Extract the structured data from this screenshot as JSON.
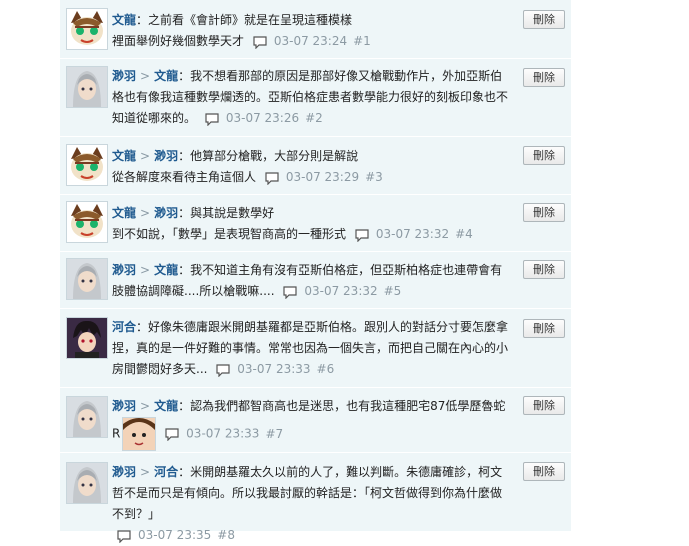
{
  "delete_label": "刪除",
  "arrow": ">",
  "posts": [
    {
      "user": "文龍",
      "to": "",
      "text": "：之前看《會計師》就是在呈現這種模樣",
      "text2": "裡面舉例好幾個數學天才",
      "time": "03-07 23:24",
      "floor": "#1"
    },
    {
      "user": "渺羽",
      "to": "文龍",
      "text": "：我不想看那部的原因是那部好像又槍戰動作片，外加亞斯伯格也有像我這種數學爛透的。亞斯伯格症患者數學能力很好的刻板印象也不知道從哪來的。",
      "time": "03-07 23:26",
      "floor": "#2"
    },
    {
      "user": "文龍",
      "to": "渺羽",
      "text": "：他算部分槍戰，大部分則是解說",
      "text2": "從各解度來看待主角這個人",
      "time": "03-07 23:29",
      "floor": "#3"
    },
    {
      "user": "文龍",
      "to": "渺羽",
      "text": "：與其說是數學好",
      "text2": "到不如說，「數學」是表現智商高的一種形式",
      "time": "03-07 23:32",
      "floor": "#4"
    },
    {
      "user": "渺羽",
      "to": "文龍",
      "text": "：我不知道主角有沒有亞斯伯格症，但亞斯柏格症也連帶會有肢體協調障礙....所以槍戰嘛....",
      "time": "03-07 23:32",
      "floor": "#5"
    },
    {
      "user": "河合",
      "to": "",
      "text": "：好像朱德庸跟米開朗基羅都是亞斯伯格。跟別人的對話分寸要怎麼拿捏，真的是一件好難的事情。常常也因為一個失言，而把自己關在內心的小房間鬱悶好多天...",
      "time": "03-07 23:33",
      "floor": "#6"
    },
    {
      "user": "渺羽",
      "to": "文龍",
      "text": "：認為我們都智商高也是迷思，也有我這種肥宅87低學歷魯蛇",
      "text2": "R",
      "time": "03-07 23:33",
      "floor": "#7"
    },
    {
      "user": "渺羽",
      "to": "河合",
      "text": "：米開朗基羅太久以前的人了，難以判斷。朱德庸確診，柯文哲不是而只是有傾向。所以我最討厭的幹話是：「柯文哲做得到你為什麼做不到？」",
      "time": "03-07 23:35",
      "floor": "#8"
    }
  ]
}
